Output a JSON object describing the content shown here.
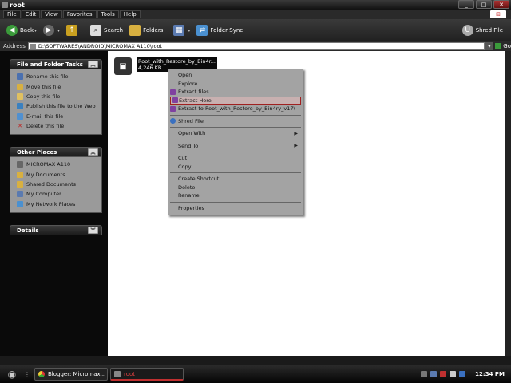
{
  "window": {
    "title": "root"
  },
  "window_buttons": {
    "minimize": "_",
    "maximize": "□",
    "close": "✕"
  },
  "menu": [
    "File",
    "Edit",
    "View",
    "Favorites",
    "Tools",
    "Help"
  ],
  "toolbar": {
    "back": "Back",
    "search": "Search",
    "folders": "Folders",
    "folder_sync": "Folder Sync",
    "shred_file": "Shred File"
  },
  "address": {
    "label": "Address",
    "value": "D:\\SOFTWARES\\ANDROID\\MICROMAX A110\\root",
    "go": "Go"
  },
  "file_tasks": {
    "title": "File and Folder Tasks",
    "items": [
      "Rename this file",
      "Move this file",
      "Copy this file",
      "Publish this file to the Web",
      "E-mail this file",
      "Delete this file"
    ]
  },
  "other_places": {
    "title": "Other Places",
    "items": [
      "MICROMAX A110",
      "My Documents",
      "Shared Documents",
      "My Computer",
      "My Network Places"
    ]
  },
  "details": {
    "title": "Details"
  },
  "file": {
    "name": "Root_with_Restore_by_Bin4r...",
    "size": "4,246 KB"
  },
  "context_menu": {
    "open": "Open",
    "explore": "Explore",
    "extract_files": "Extract files...",
    "extract_here": "Extract Here",
    "extract_to": "Extract to Root_with_Restore_by_Bin4ry_v17\\",
    "shred_file": "Shred File",
    "open_with": "Open With",
    "send_to": "Send To",
    "cut": "Cut",
    "copy": "Copy",
    "create_shortcut": "Create Shortcut",
    "delete": "Delete",
    "rename": "Rename",
    "properties": "Properties"
  },
  "taskbar": {
    "items": [
      "Blogger: Micromax...",
      "root"
    ],
    "clock": "12:34 PM"
  },
  "colors": {
    "highlight": "#a02020",
    "taskbar_active": "#e04040"
  }
}
